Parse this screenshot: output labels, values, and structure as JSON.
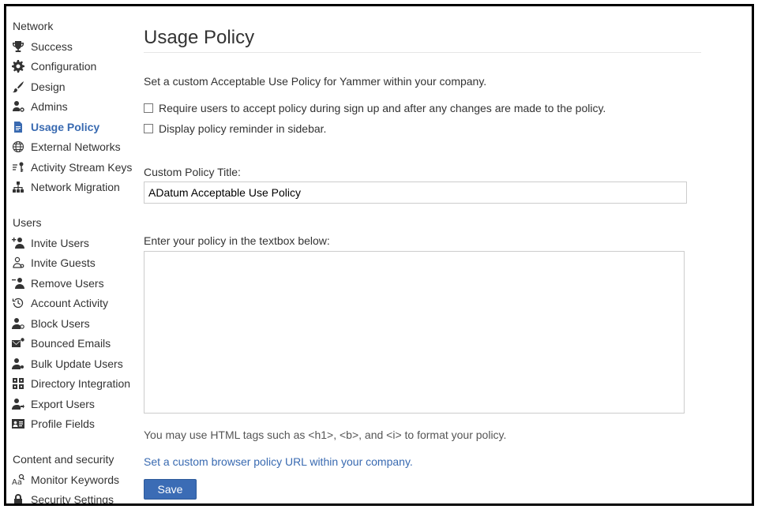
{
  "sidebar": {
    "network_header": "Network",
    "network_items": [
      {
        "label": "Success",
        "icon": "trophy-icon"
      },
      {
        "label": "Configuration",
        "icon": "gear-icon"
      },
      {
        "label": "Design",
        "icon": "brush-icon"
      },
      {
        "label": "Admins",
        "icon": "admin-user-icon"
      },
      {
        "label": "Usage Policy",
        "icon": "document-icon",
        "active": true
      },
      {
        "label": "External Networks",
        "icon": "globe-icon"
      },
      {
        "label": "Activity Stream Keys",
        "icon": "key-icon"
      },
      {
        "label": "Network Migration",
        "icon": "hierarchy-icon"
      }
    ],
    "users_header": "Users",
    "users_items": [
      {
        "label": "Invite Users",
        "icon": "add-user-icon"
      },
      {
        "label": "Invite Guests",
        "icon": "guest-user-icon"
      },
      {
        "label": "Remove Users",
        "icon": "remove-user-icon"
      },
      {
        "label": "Account Activity",
        "icon": "history-icon"
      },
      {
        "label": "Block Users",
        "icon": "block-user-icon"
      },
      {
        "label": "Bounced Emails",
        "icon": "bounced-mail-icon"
      },
      {
        "label": "Bulk Update Users",
        "icon": "bulk-users-icon"
      },
      {
        "label": "Directory Integration",
        "icon": "directory-icon"
      },
      {
        "label": "Export Users",
        "icon": "export-users-icon"
      },
      {
        "label": "Profile Fields",
        "icon": "id-card-icon"
      }
    ],
    "content_header": "Content and security",
    "content_items": [
      {
        "label": "Monitor Keywords",
        "icon": "keyword-search-icon"
      },
      {
        "label": "Security Settings",
        "icon": "lock-icon"
      }
    ]
  },
  "main": {
    "title": "Usage Policy",
    "intro": "Set a custom Acceptable Use Policy for Yammer within your company.",
    "checkbox_require": "Require users to accept policy during sign up and after any changes are made to the policy.",
    "checkbox_reminder": "Display policy reminder in sidebar.",
    "custom_title_label": "Custom Policy Title:",
    "custom_title_value": "ADatum Acceptable Use Policy",
    "policy_label": "Enter your policy in the textbox below:",
    "policy_text": "",
    "hint": "You may use HTML tags such as <h1>, <b>, and <i> to format your policy.",
    "browser_policy_link": "Set a custom browser policy URL within your company.",
    "save_label": "Save"
  },
  "colors": {
    "accent": "#396ab1",
    "button": "#3b6cb5"
  }
}
